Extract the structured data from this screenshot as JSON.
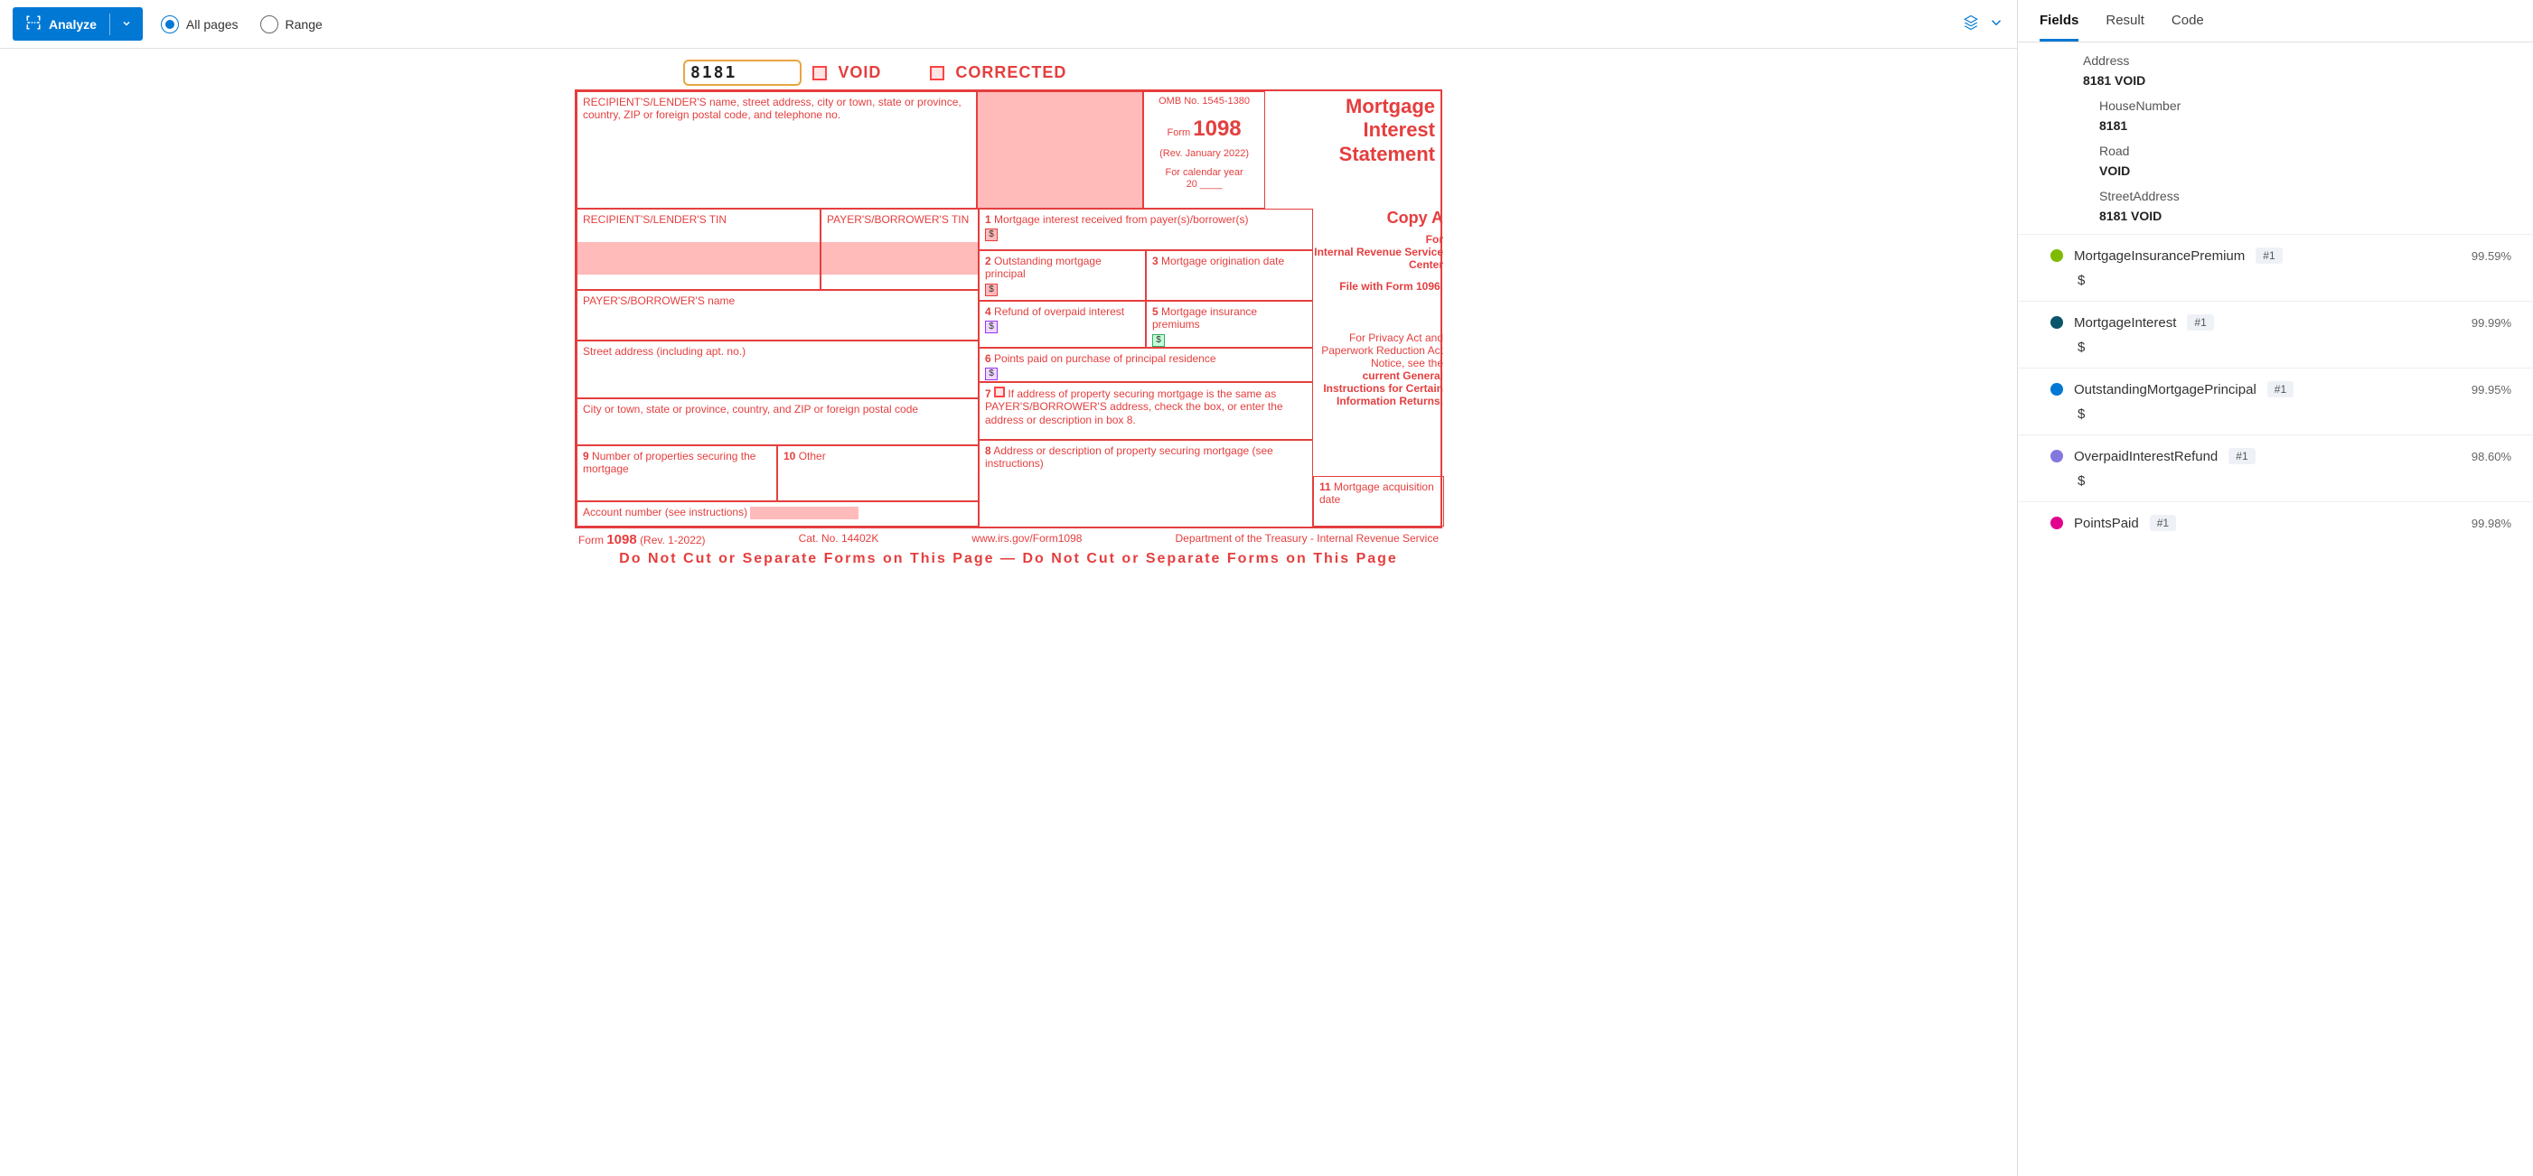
{
  "toolbar": {
    "analyze_label": "Analyze",
    "all_pages_label": "All pages",
    "range_label": "Range"
  },
  "form": {
    "top_code": "8181",
    "void_label": "VOID",
    "corrected_label": "CORRECTED",
    "recipient_header": "RECIPIENT'S/LENDER'S name, street address, city or town, state or province, country, ZIP or foreign postal code, and telephone no.",
    "omb": "OMB No. 1545-1380",
    "form_word": "Form",
    "form_num": "1098",
    "rev_date": "(Rev. January 2022)",
    "cal_year": "For calendar year",
    "cal_year_prefix": "20",
    "title_line1": "Mortgage",
    "title_line2": "Interest",
    "title_line3": "Statement",
    "box1": "Mortgage interest received from payer(s)/borrower(s)",
    "recipient_tin": "RECIPIENT'S/LENDER'S TIN",
    "payer_tin": "PAYER'S/BORROWER'S TIN",
    "box2": "Outstanding mortgage principal",
    "box3": "Mortgage origination date",
    "box4": "Refund of overpaid interest",
    "box5": "Mortgage insurance premiums",
    "payer_name": "PAYER'S/BORROWER'S name",
    "box6": "Points paid on purchase of principal residence",
    "street": "Street address (including apt. no.)",
    "box7": "If address of property securing mortgage is the same as PAYER'S/BORROWER'S address, check the box, or enter the address or description in box 8.",
    "city": "City or town, state or province, country, and ZIP or foreign postal code",
    "box8": "Address or description of property securing mortgage (see instructions)",
    "box9": "Number of properties securing the mortgage",
    "box10": "Other",
    "box11": "Mortgage acquisition date",
    "acct_num": "Account number (see instructions)",
    "copy_a": "Copy A",
    "for_label": "For",
    "irs_center": "Internal Revenue Service Center",
    "file_with": "File with Form 1096.",
    "privacy": "For Privacy Act and Paperwork Reduction Act Notice, see the",
    "privacy_bold": "current General Instructions for Certain Information Returns.",
    "footer_form": "Form",
    "footer_num": "1098",
    "footer_rev": "(Rev. 1-2022)",
    "cat": "Cat. No. 14402K",
    "url": "www.irs.gov/Form1098",
    "dept": "Department of the Treasury - Internal Revenue Service",
    "nocut": "Do  Not  Cut  or  Separate  Forms  on  This  Page    —    Do  Not  Cut  or  Separate  Forms  on  This  Page"
  },
  "tabs": {
    "fields": "Fields",
    "result": "Result",
    "code": "Code"
  },
  "panel": {
    "address_label": "Address",
    "address_value": "8181 VOID",
    "house_label": "HouseNumber",
    "house_value": "8181",
    "road_label": "Road",
    "road_value": "VOID",
    "street_label": "StreetAddress",
    "street_value": "8181 VOID",
    "fields": [
      {
        "name": "MortgageInsurancePremium",
        "badge": "#1",
        "confidence": "99.59%",
        "value": "$",
        "color": "#7fba00"
      },
      {
        "name": "MortgageInterest",
        "badge": "#1",
        "confidence": "99.99%",
        "value": "$",
        "color": "#0b556a"
      },
      {
        "name": "OutstandingMortgagePrincipal",
        "badge": "#1",
        "confidence": "99.95%",
        "value": "$",
        "color": "#0078d4"
      },
      {
        "name": "OverpaidInterestRefund",
        "badge": "#1",
        "confidence": "98.60%",
        "value": "$",
        "color": "#8378de"
      },
      {
        "name": "PointsPaid",
        "badge": "#1",
        "confidence": "99.98%",
        "value": "",
        "color": "#e3008c"
      }
    ]
  }
}
